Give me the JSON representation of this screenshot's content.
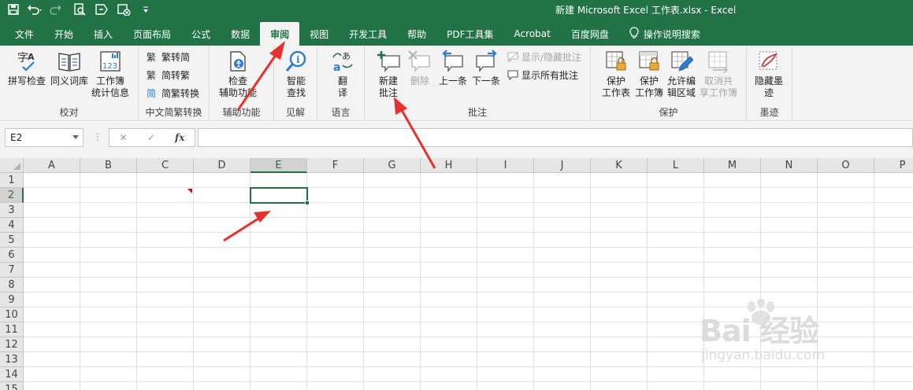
{
  "title_bar": {
    "window_title": "新建 Microsoft Excel 工作表.xlsx  -  Excel",
    "qat_icons": [
      "save-icon",
      "undo-icon",
      "redo-icon",
      "print-preview-icon",
      "touch-mode-icon",
      "clear-icon",
      "customize-icon"
    ]
  },
  "tabs": [
    {
      "label": "文件"
    },
    {
      "label": "开始"
    },
    {
      "label": "插入"
    },
    {
      "label": "页面布局"
    },
    {
      "label": "公式"
    },
    {
      "label": "数据"
    },
    {
      "label": "审阅",
      "active": true
    },
    {
      "label": "视图"
    },
    {
      "label": "开发工具"
    },
    {
      "label": "帮助"
    },
    {
      "label": "PDF工具集"
    },
    {
      "label": "Acrobat"
    },
    {
      "label": "百度网盘"
    },
    {
      "label": "操作说明搜索"
    }
  ],
  "ribbon": {
    "proofing": {
      "label": "校对",
      "spell_check": "拼写检查",
      "thesaurus": "同义词库",
      "workbook_stats_line1": "工作簿",
      "workbook_stats_line2": "统计信息"
    },
    "chinese_conversion": {
      "label": "中文简繁转换",
      "to_simplified": "繁转简",
      "to_traditional": "简转繁",
      "conversion": "简繁转换"
    },
    "accessibility": {
      "label": "辅助功能",
      "check_line1": "检查",
      "check_line2": "辅助功能"
    },
    "insights": {
      "label": "见解",
      "smart_lookup_line1": "智能",
      "smart_lookup_line2": "查找"
    },
    "language": {
      "label": "语言",
      "translate_line1": "翻",
      "translate_line2": "译"
    },
    "comments": {
      "label": "批注",
      "new_comment_line1": "新建",
      "new_comment_line2": "批注",
      "delete": "删除",
      "previous": "上一条",
      "next": "下一条",
      "show_hide": "显示/隐藏批注",
      "show_all": "显示所有批注"
    },
    "protect": {
      "label": "保护",
      "protect_sheet_line1": "保护",
      "protect_sheet_line2": "工作表",
      "protect_workbook_line1": "保护",
      "protect_workbook_line2": "工作簿",
      "allow_edit_line1": "允许编",
      "allow_edit_line2": "辑区域",
      "unshare_line1": "取消共",
      "unshare_line2": "享工作簿"
    },
    "ink": {
      "label": "墨迹",
      "hide_ink_line1": "隐藏墨",
      "hide_ink_line2": "迹"
    }
  },
  "formula_bar": {
    "name_box": "E2",
    "fx_label": "fx",
    "formula": ""
  },
  "sheet": {
    "columns": [
      "A",
      "B",
      "C",
      "D",
      "E",
      "F",
      "G",
      "H",
      "I",
      "J",
      "K",
      "L",
      "M",
      "N",
      "O",
      "P"
    ],
    "rows": [
      "1",
      "2",
      "3",
      "4",
      "5",
      "6",
      "7",
      "8",
      "9",
      "10",
      "11",
      "12",
      "13",
      "14",
      "15"
    ],
    "active_cell": "E2",
    "comment_cell": "C2"
  },
  "watermark": {
    "brand": "Bai 经验",
    "url": "jingyan.baidu.com"
  },
  "colors": {
    "excel_green": "#217346",
    "ribbon_bg": "#f3f3f3",
    "annotation_red": "#e8312f"
  }
}
